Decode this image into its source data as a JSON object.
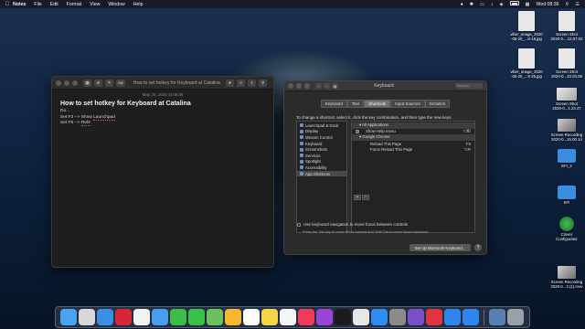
{
  "menubar": {
    "app_name": "Notes",
    "menus": [
      "File",
      "Edit",
      "Format",
      "View",
      "Window",
      "Help"
    ],
    "clock": "Wed 08:36"
  },
  "notes": {
    "window_title": "How to set hotkey for Keyboard at Catalina",
    "toolbar_aa": "Aa",
    "date": "May 20, 2020 at 08:36",
    "title": "How to set hotkey for Keyboard at Catalina",
    "lines": [
      {
        "text": "Do...",
        "underline": ""
      },
      {
        "text": "Set F3 --> Show ",
        "underline": "Launchpad"
      },
      {
        "text": "Set F5 --> ",
        "underline": "Refe"
      }
    ]
  },
  "keyboard": {
    "window_title": "Keyboard",
    "search_placeholder": "Search",
    "tabs": [
      "Keyboard",
      "Text",
      "Shortcuts",
      "Input Sources",
      "Dictation"
    ],
    "active_tab": "Shortcuts",
    "instructions": "To change a shortcut, select it, click the key combination, and then type the new keys.",
    "categories": [
      "Launchpad & Dock",
      "Display",
      "Mission Control",
      "Keyboard",
      "Screenshots",
      "Services",
      "Spotlight",
      "Accessibility",
      "App Shortcuts"
    ],
    "selected_category": "App Shortcuts",
    "shortcut_rows": [
      {
        "label": "▾ All Applications",
        "shortcut": "",
        "check": false,
        "group": true
      },
      {
        "label": "Show Help menu",
        "shortcut": "⇧⌘/",
        "check": true,
        "group": false
      },
      {
        "label": "▾ Google Chrome",
        "shortcut": "",
        "check": false,
        "group": true
      },
      {
        "label": "Reload This Page",
        "shortcut": "F5",
        "check": false,
        "group": false
      },
      {
        "label": "Force Reload This Page",
        "shortcut": "⌥R",
        "check": false,
        "group": false
      }
    ],
    "add_label": "+",
    "remove_label": "−",
    "nav_checkbox_label": "Use keyboard navigation to move focus between controls",
    "nav_hint": "Press the Tab key to move focus forward and Shift Tab to move focus backward.",
    "bluetooth_button": "Set Up Bluetooth Keyboard...",
    "help_label": "?"
  },
  "desktop_icons": [
    {
      "label": "viber_image_2020\n-05-20_...8-18.jpg",
      "kind": "doc"
    },
    {
      "label": "Screen Shot\n2020-0....12.07.02",
      "kind": "shot"
    },
    {
      "label": "viber_image_2020\n-05-20_...8-25.jpg",
      "kind": "doc"
    },
    {
      "label": "Screen Shot\n2020-0...10.03.08",
      "kind": "shot"
    },
    {
      "label": "Screen Shot\n2020-0...1.23.47",
      "kind": "shot"
    },
    {
      "label": "Screen Recording\n2020-0...15.00.14",
      "kind": "movie"
    },
    {
      "label": "EFI_2",
      "kind": "folder"
    },
    {
      "label": "EFI",
      "kind": "folder"
    },
    {
      "label": "Clover\nConfigurator",
      "kind": "clover"
    },
    {
      "label": "Screen Recording\n2020-0...3 (1).mov",
      "kind": "movie"
    }
  ],
  "dock": {
    "icons": [
      {
        "name": "finder-icon",
        "color": "#4aa3f0"
      },
      {
        "name": "launchpad-icon",
        "color": "#d8d8d8"
      },
      {
        "name": "safari-icon",
        "color": "#3b8fe3"
      },
      {
        "name": "opera-icon",
        "color": "#d5263a"
      },
      {
        "name": "photos-icon",
        "color": "#f2f2f2"
      },
      {
        "name": "mail-icon",
        "color": "#4a9ef0"
      },
      {
        "name": "facetime-icon",
        "color": "#3bbd4a"
      },
      {
        "name": "messages-icon",
        "color": "#39c24a"
      },
      {
        "name": "maps-icon",
        "color": "#6dc15c"
      },
      {
        "name": "photo-app-icon",
        "color": "#f5b630"
      },
      {
        "name": "calendar-icon",
        "color": "#ffffff"
      },
      {
        "name": "notes-icon",
        "color": "#f7d54a"
      },
      {
        "name": "reminders-icon",
        "color": "#f5f5f5"
      },
      {
        "name": "music-icon",
        "color": "#f23a5c"
      },
      {
        "name": "podcasts-icon",
        "color": "#9b44d6"
      },
      {
        "name": "tv-icon",
        "color": "#1b1b1b"
      },
      {
        "name": "chrome-icon",
        "color": "#e7e7e7"
      },
      {
        "name": "appstore-icon",
        "color": "#2f8cf0"
      },
      {
        "name": "system-preferences-icon",
        "color": "#8b8b8b"
      },
      {
        "name": "viber-icon",
        "color": "#7b4fc9"
      },
      {
        "name": "vivaldi-icon",
        "color": "#e0343e"
      },
      {
        "name": "zalo-icon",
        "color": "#2f86f0"
      },
      {
        "name": "zalo-video-icon",
        "color": "#2f86f0"
      },
      {
        "name": "downloads-icon",
        "color": "#5a7fb3"
      },
      {
        "name": "trash-icon",
        "color": "#9aa0a6"
      }
    ],
    "separator_before_index": 23
  }
}
